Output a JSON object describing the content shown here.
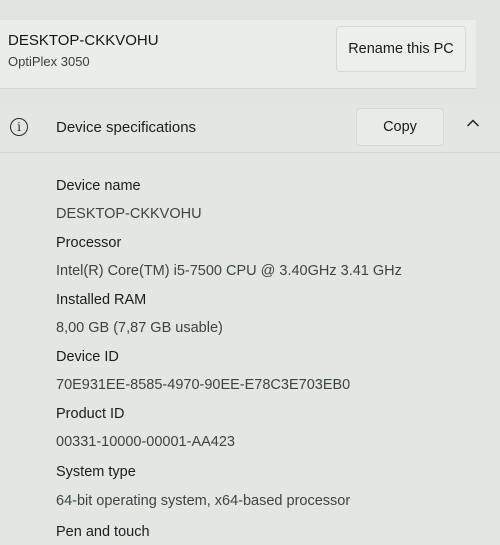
{
  "device": {
    "name": "DESKTOP-CKKVOHU",
    "model": "OptiPlex 3050",
    "rename_label": "Rename this PC"
  },
  "specs": {
    "title": "Device specifications",
    "copy_label": "Copy",
    "items": [
      {
        "label": "Device name",
        "value": "DESKTOP-CKKVOHU"
      },
      {
        "label": "Processor",
        "value": "Intel(R) Core(TM) i5-7500 CPU @ 3.40GHz   3.41 GHz"
      },
      {
        "label": "Installed RAM",
        "value": "8,00 GB (7,87 GB usable)"
      },
      {
        "label": "Device ID",
        "value": "70E931EE-8585-4970-90EE-E78C3E703EB0"
      },
      {
        "label": "Product ID",
        "value": "00331-10000-00001-AA423"
      },
      {
        "label": "System type",
        "value": "64-bit operating system, x64-based processor"
      },
      {
        "label": "Pen and touch",
        "value": ""
      }
    ]
  },
  "icons": {
    "info": "info-circle-icon",
    "collapse": "chevron-up-icon"
  }
}
